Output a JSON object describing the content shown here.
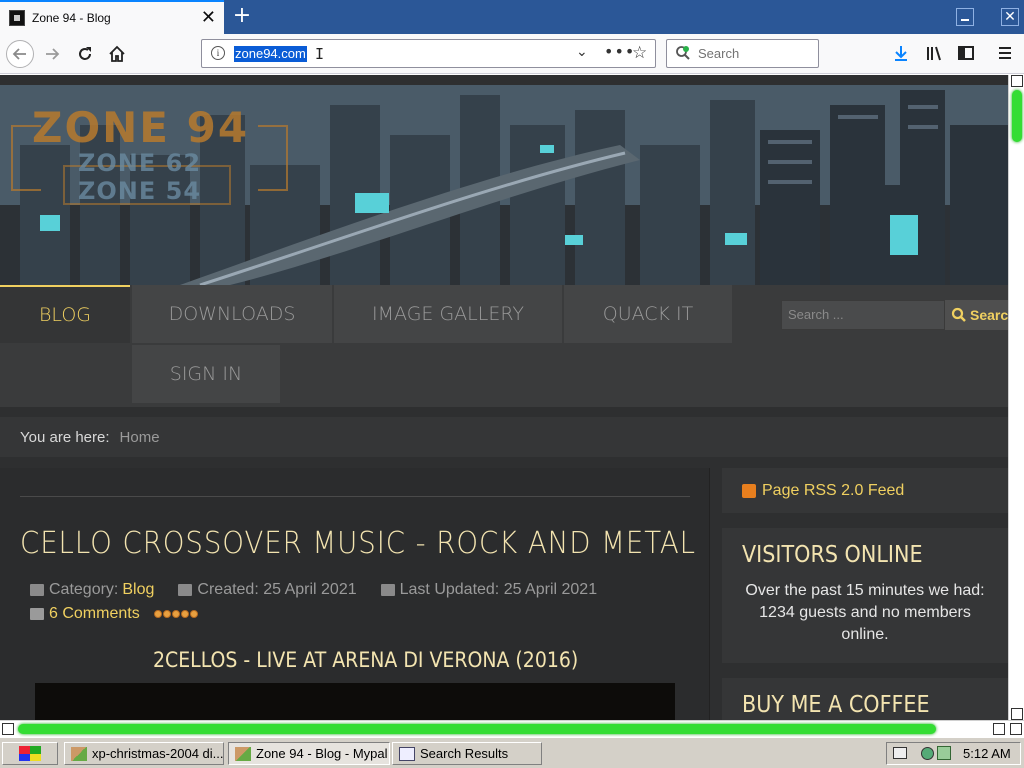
{
  "browser": {
    "tab_title": "Zone 94 - Blog",
    "url": "zone94.com",
    "search_placeholder": "Search"
  },
  "site": {
    "logo": {
      "main": "ZONE 94",
      "sub1": "ZONE 62",
      "sub2": "ZONE 54"
    },
    "nav": [
      {
        "label": "BLOG",
        "active": true
      },
      {
        "label": "DOWNLOADS",
        "active": false
      },
      {
        "label": "IMAGE GALLERY",
        "active": false
      },
      {
        "label": "QUACK IT",
        "active": false
      },
      {
        "label": "SIGN IN",
        "active": false
      }
    ],
    "search": {
      "placeholder": "Search ...",
      "button_label": "Search"
    },
    "breadcrumb": {
      "label": "You are here:",
      "home": "Home"
    },
    "article": {
      "title": "CELLO CROSSOVER MUSIC - ROCK AND METAL",
      "category_label": "Category:",
      "category": "Blog",
      "created": "Created: 25 April 2021",
      "updated": "Last Updated: 25 April 2021",
      "comments": "6 Comments",
      "video_title": "2CELLOS - LIVE AT ARENA DI VERONA (2016)"
    },
    "sidebar": {
      "rss_label": "Page RSS 2.0 Feed",
      "visitors_title": "VISITORS ONLINE",
      "visitors_text": "Over the past 15 minutes we had: 1234 guests and no members online.",
      "coffee_title": "BUY ME A COFFEE"
    }
  },
  "taskbar": {
    "tasks": [
      {
        "label": "xp-christmas-2004 di..."
      },
      {
        "label": "Zone 94 - Blog - Mypal"
      },
      {
        "label": "Search Results"
      }
    ],
    "clock": "5:12 AM"
  },
  "colors": {
    "accent_yellow": "#f0d060",
    "heading_cream": "#f3e4b0",
    "scroll_green": "#33dd33",
    "tabstrip_blue": "#2b5797"
  }
}
